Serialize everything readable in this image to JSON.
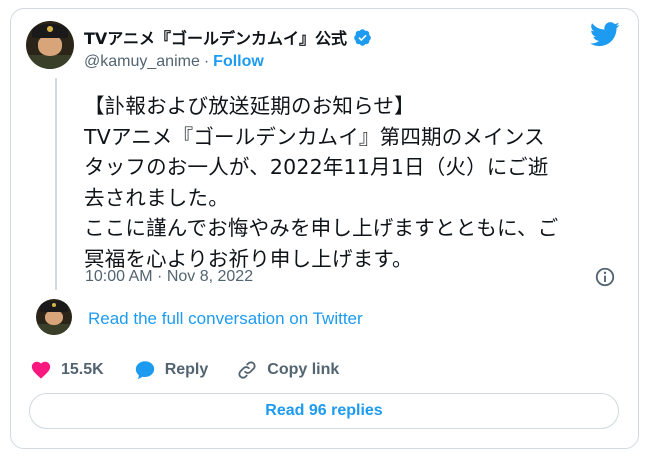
{
  "author": {
    "display_name": "TVアニメ『ゴールデンカムイ』公式",
    "handle": "@kamuy_anime",
    "separator": "·",
    "follow_label": "Follow"
  },
  "tweet": {
    "text": "【訃報および放送延期のお知らせ】\nTVアニメ『ゴールデンカムイ』第四期のメインス\nタッフのお一人が、2022年11月1日（火）にご逝\n去されました。\nここに謹んでお悔やみを申し上げますとともに、ご\n冥福を心よりお祈り申し上げます。",
    "timestamp": "10:00 AM · Nov 8, 2022"
  },
  "conversation_link": "Read the full conversation on Twitter",
  "actions": {
    "like_count": "15.5K",
    "reply_label": "Reply",
    "copy_link_label": "Copy link"
  },
  "read_replies_label": "Read 96 replies",
  "colors": {
    "accent": "#1d9bf0",
    "like": "#f91880",
    "muted": "#536471",
    "border": "#cfd9de"
  },
  "icons": {
    "brand": "twitter-bird-icon",
    "verified": "verified-badge-icon",
    "info": "info-icon",
    "like": "heart-icon",
    "reply": "speech-bubble-icon",
    "copy": "link-icon"
  }
}
